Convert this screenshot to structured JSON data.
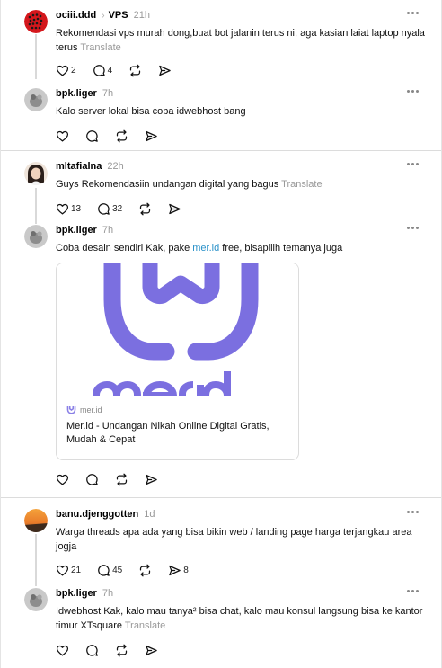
{
  "threads": [
    {
      "post": {
        "username": "ociii.ddd",
        "topic": "VPS",
        "time": "21h",
        "text": "Rekomendasi vps murah dong,buat bot jalanin terus ni, aga kasian laiat laptop nyala terus",
        "translate": "Translate",
        "likes": "2",
        "replies": "4"
      },
      "reply": {
        "username": "bpk.liger",
        "time": "7h",
        "text": "Kalo server lokal bisa coba idwebhost bang"
      }
    },
    {
      "post": {
        "username": "mltafialna",
        "time": "22h",
        "text": "Guys Rekomendasiin undangan digital yang bagus",
        "translate": "Translate",
        "likes": "13",
        "replies": "32"
      },
      "reply": {
        "username": "bpk.liger",
        "time": "7h",
        "text_before": "Coba desain sendiri Kak, pake ",
        "link": "mer.id",
        "text_after": " free, bisapilih temanya juga",
        "card": {
          "domain": "mer.id",
          "title": "Mer.id - Undangan Nikah Online Digital Gratis, Mudah & Cepat",
          "brand_color": "#7b6fe0"
        }
      }
    },
    {
      "post": {
        "username": "banu.djenggotten",
        "time": "1d",
        "text": "Warga threads apa ada yang bisa bikin web / landing page harga terjangkau area jogja",
        "likes": "21",
        "replies": "45",
        "shares": "8"
      },
      "reply": {
        "username": "bpk.liger",
        "time": "7h",
        "text": "Idwebhost Kak, kalo mau tanya² bisa chat, kalo mau konsul langsung bisa ke kantor timur XTsquare",
        "translate": "Translate"
      }
    }
  ],
  "icons": [
    "heart-icon",
    "comment-icon",
    "repost-icon",
    "share-icon",
    "more-icon"
  ],
  "colors": {
    "link": "#2a91c9",
    "muted": "#999999",
    "divider": "#dcdcdc"
  }
}
